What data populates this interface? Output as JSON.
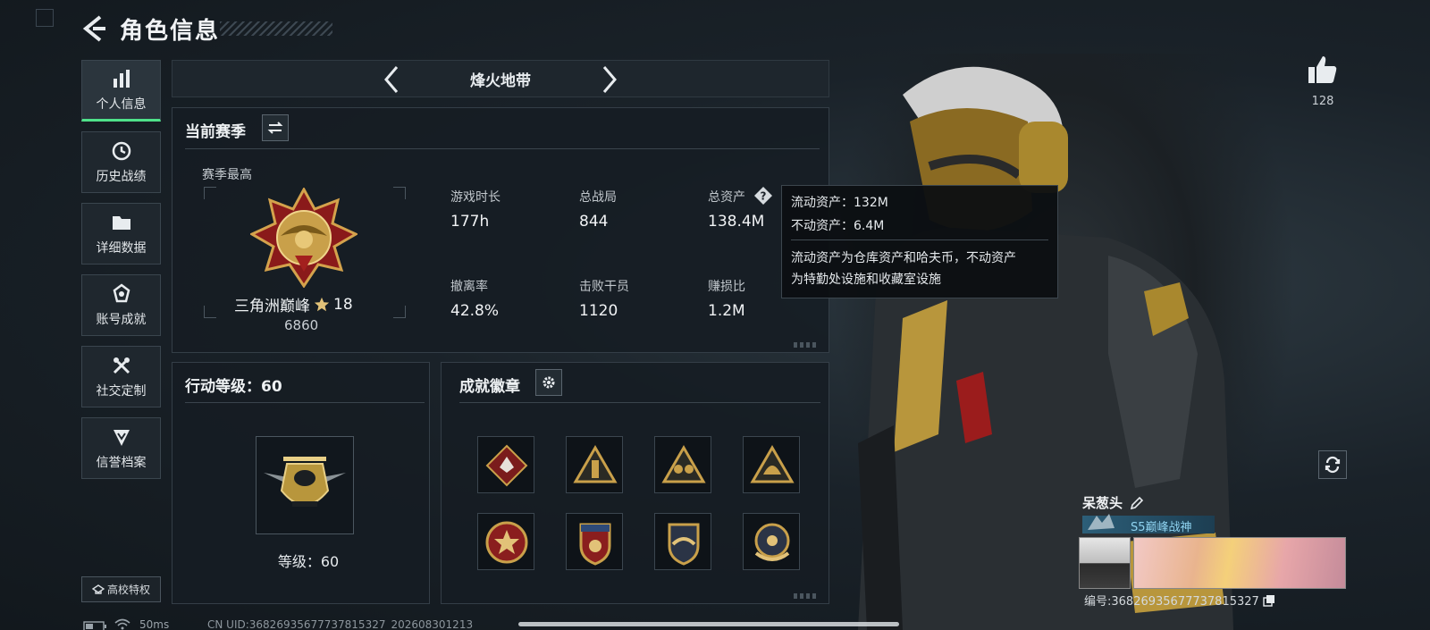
{
  "header": {
    "title": "角色信息"
  },
  "sidebar": {
    "items": [
      {
        "label": "个人信息",
        "icon": "bar-chart-icon",
        "active": true
      },
      {
        "label": "历史战绩",
        "icon": "clock-icon",
        "active": false
      },
      {
        "label": "详细数据",
        "icon": "folder-icon",
        "active": false
      },
      {
        "label": "账号成就",
        "icon": "achievement-icon",
        "active": false
      },
      {
        "label": "社交定制",
        "icon": "tools-icon",
        "active": false
      },
      {
        "label": "信誉档案",
        "icon": "reputation-icon",
        "active": false
      }
    ],
    "school_label": "高校特权"
  },
  "mode": {
    "name": "烽火地带"
  },
  "season": {
    "title": "当前赛季",
    "season_high_label": "赛季最高",
    "rank_name": "三角洲巅峰",
    "rank_stars": "18",
    "rank_score": "6860",
    "stats": [
      {
        "label": "游戏时长",
        "value": "177h"
      },
      {
        "label": "总战局",
        "value": "844"
      },
      {
        "label": "总资产",
        "value": "138.4M"
      },
      {
        "label": "撤离率",
        "value": "42.8%"
      },
      {
        "label": "击败干员",
        "value": "1120"
      },
      {
        "label": "赚损比",
        "value": "1.2M"
      }
    ]
  },
  "tooltip": {
    "liquid": "流动资产：132M",
    "fixed": "不动资产：6.4M",
    "desc_line1": "流动资产为仓库资产和哈夫币，不动资产",
    "desc_line2": "为特勤处设施和收藏室设施"
  },
  "level": {
    "title": "行动等级：60",
    "label": "等级：60"
  },
  "badges": {
    "title": "成就徽章",
    "items": [
      "diamond-wolf-badge",
      "triangle-soldier-badge",
      "triangle-squad-badge",
      "triangle-helmet-badge",
      "round-star-badge",
      "shield-stripe-badge",
      "shield-wing-badge",
      "round-wing-badge"
    ]
  },
  "profile": {
    "likes": "128",
    "name": "呆葱头",
    "title_badge": "S5巅峰战神",
    "id_text": "编号:368269356777378153​27"
  },
  "status_bar": {
    "ping": "50ms",
    "uid": "CN UID:368269356777378153​27_20260830121​3"
  },
  "colors": {
    "accent": "#4fe28a",
    "gold": "#c9a04a",
    "panel_bg": "#161d23"
  }
}
